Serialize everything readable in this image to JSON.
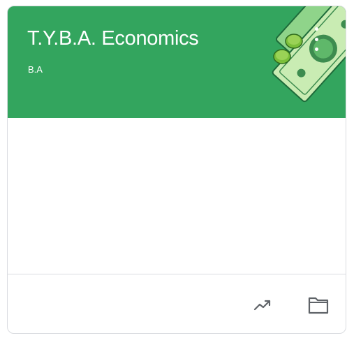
{
  "class_card": {
    "title": "T.Y.B.A. Economics",
    "section": "B.A",
    "header_color": "#33a55e",
    "illustration_icon": "money-illustration",
    "menu_icon": "more-vert-icon",
    "footer_actions": [
      {
        "icon": "trending-up-icon"
      },
      {
        "icon": "folder-icon"
      }
    ]
  }
}
